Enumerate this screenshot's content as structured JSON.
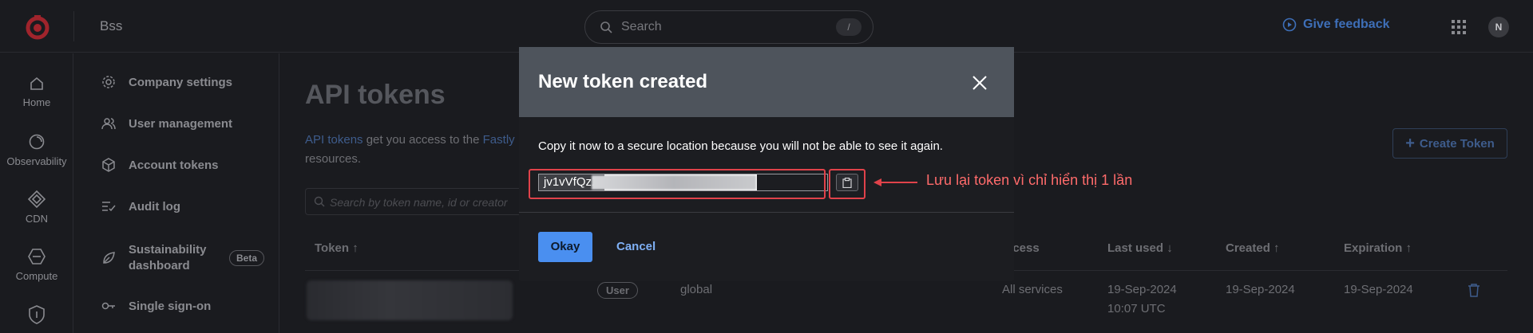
{
  "topbar": {
    "app_name": "Bss",
    "search_placeholder": "Search",
    "search_shortcut": "/",
    "feedback_label": "Give feedback",
    "avatar_initial": "N"
  },
  "rail": {
    "items": [
      {
        "label": "Home",
        "icon": "home-icon"
      },
      {
        "label": "Observability",
        "icon": "observability-icon"
      },
      {
        "label": "CDN",
        "icon": "cdn-icon"
      },
      {
        "label": "Compute",
        "icon": "compute-icon"
      },
      {
        "label": "",
        "icon": "security-icon"
      }
    ]
  },
  "subnav": {
    "items": [
      {
        "label": "Company settings",
        "icon": "gear-icon"
      },
      {
        "label": "User management",
        "icon": "users-icon"
      },
      {
        "label": "Account tokens",
        "icon": "token-icon"
      },
      {
        "label": "Audit log",
        "icon": "audit-icon"
      },
      {
        "label": "Sustainability dashboard",
        "icon": "leaf-icon",
        "badge": "Beta"
      },
      {
        "label": "Single sign-on",
        "icon": "key-icon"
      }
    ]
  },
  "main": {
    "title": "API tokens",
    "intro_link1": "API tokens",
    "intro_text1": " get you access to the ",
    "intro_link2": "Fastly",
    "intro_text2": "resources.",
    "create_label": "Create Token",
    "filter_placeholder": "Search by token name, id or creator",
    "columns": {
      "token": "Token",
      "access": "ccess",
      "last_used": "Last used",
      "created": "Created",
      "expiration": "Expiration"
    },
    "row": {
      "role": "User",
      "scope": "global",
      "access": "All services",
      "last_used_date": "19-Sep-2024",
      "last_used_time": "10:07 UTC",
      "created": "19-Sep-2024",
      "expiration": "19-Sep-2024"
    }
  },
  "modal": {
    "title": "New token created",
    "message": "Copy it now to a secure location because you will not be able to see it again.",
    "token_visible": "jv1vVfQzX",
    "okay_label": "Okay",
    "cancel_label": "Cancel"
  },
  "annotation": {
    "text": "Lưu lại token vì chỉ hiển thị 1 lần",
    "color": "#e0424a"
  },
  "colors": {
    "accent": "#4a8ff0",
    "modal_header": "#4e545c",
    "background": "#1a1b1f"
  }
}
